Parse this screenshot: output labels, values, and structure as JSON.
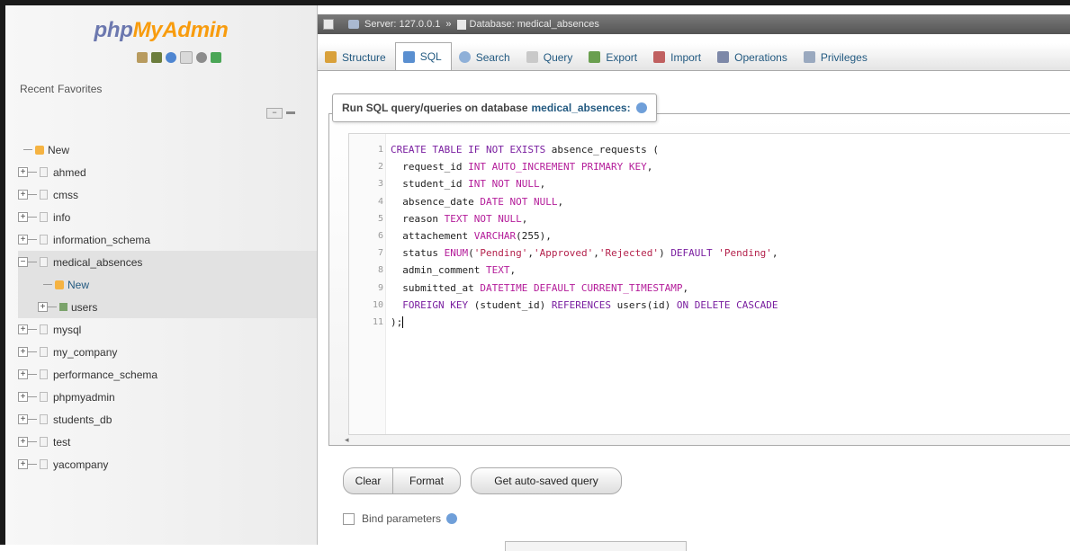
{
  "sidebar": {
    "logo_part1": "php",
    "logo_part2": "MyAdmin",
    "recent_tab": "Recent",
    "favorites_tab": "Favorites",
    "tree": [
      {
        "label": "New"
      },
      {
        "label": "ahmed"
      },
      {
        "label": "cmss"
      },
      {
        "label": "info"
      },
      {
        "label": "information_schema"
      },
      {
        "label": "medical_absences"
      },
      {
        "label": "New"
      },
      {
        "label": "users"
      },
      {
        "label": "mysql"
      },
      {
        "label": "my_company"
      },
      {
        "label": "performance_schema"
      },
      {
        "label": "phpmyadmin"
      },
      {
        "label": "students_db"
      },
      {
        "label": "test"
      },
      {
        "label": "yacompany"
      }
    ]
  },
  "breadcrumb": {
    "server": "Server: 127.0.0.1",
    "separator": "»",
    "database": "Database: medical_absences"
  },
  "tabs": [
    {
      "label": "Structure"
    },
    {
      "label": "SQL"
    },
    {
      "label": "Search"
    },
    {
      "label": "Query"
    },
    {
      "label": "Export"
    },
    {
      "label": "Import"
    },
    {
      "label": "Operations"
    },
    {
      "label": "Privileges"
    }
  ],
  "sql_panel": {
    "legend_prefix": "Run SQL query/queries on database",
    "legend_db": "medical_absences:",
    "lines": [
      {
        "n": "1",
        "segs": [
          {
            "t": "CREATE TABLE IF NOT EXISTS",
            "c": "kw"
          },
          {
            "t": " absence_requests (",
            "c": ""
          }
        ]
      },
      {
        "n": "2",
        "segs": [
          {
            "t": "  request_id ",
            "c": ""
          },
          {
            "t": "INT AUTO_INCREMENT PRIMARY KEY",
            "c": "ty"
          },
          {
            "t": ",",
            "c": ""
          }
        ]
      },
      {
        "n": "3",
        "segs": [
          {
            "t": "  student_id ",
            "c": ""
          },
          {
            "t": "INT NOT NULL",
            "c": "ty"
          },
          {
            "t": ",",
            "c": ""
          }
        ]
      },
      {
        "n": "4",
        "segs": [
          {
            "t": "  absence_date ",
            "c": ""
          },
          {
            "t": "DATE NOT NULL",
            "c": "ty"
          },
          {
            "t": ",",
            "c": ""
          }
        ]
      },
      {
        "n": "5",
        "segs": [
          {
            "t": "  reason ",
            "c": ""
          },
          {
            "t": "TEXT NOT NULL",
            "c": "ty"
          },
          {
            "t": ",",
            "c": ""
          }
        ]
      },
      {
        "n": "6",
        "segs": [
          {
            "t": "  attachement ",
            "c": ""
          },
          {
            "t": "VARCHAR",
            "c": "ty"
          },
          {
            "t": "(255),",
            "c": ""
          }
        ]
      },
      {
        "n": "7",
        "segs": [
          {
            "t": "  status ",
            "c": ""
          },
          {
            "t": "ENUM",
            "c": "ty"
          },
          {
            "t": "(",
            "c": ""
          },
          {
            "t": "'Pending'",
            "c": "st"
          },
          {
            "t": ",",
            "c": ""
          },
          {
            "t": "'Approved'",
            "c": "st"
          },
          {
            "t": ",",
            "c": ""
          },
          {
            "t": "'Rejected'",
            "c": "st"
          },
          {
            "t": ") ",
            "c": ""
          },
          {
            "t": "DEFAULT",
            "c": "kw"
          },
          {
            "t": " ",
            "c": ""
          },
          {
            "t": "'Pending'",
            "c": "st"
          },
          {
            "t": ",",
            "c": ""
          }
        ]
      },
      {
        "n": "8",
        "segs": [
          {
            "t": "  admin_comment ",
            "c": ""
          },
          {
            "t": "TEXT",
            "c": "ty"
          },
          {
            "t": ",",
            "c": ""
          }
        ]
      },
      {
        "n": "9",
        "segs": [
          {
            "t": "  submitted_at ",
            "c": ""
          },
          {
            "t": "DATETIME DEFAULT CURRENT_TIMESTAMP",
            "c": "ty"
          },
          {
            "t": ",",
            "c": ""
          }
        ]
      },
      {
        "n": "10",
        "segs": [
          {
            "t": "  FOREIGN KEY",
            "c": "kw"
          },
          {
            "t": " (student_id) ",
            "c": ""
          },
          {
            "t": "REFERENCES",
            "c": "kw"
          },
          {
            "t": " users(id) ",
            "c": ""
          },
          {
            "t": "ON DELETE CASCADE",
            "c": "kw"
          }
        ]
      },
      {
        "n": "11",
        "segs": [
          {
            "t": ");",
            "c": ""
          }
        ]
      }
    ]
  },
  "buttons": {
    "clear": "Clear",
    "format": "Format",
    "auto_saved": "Get auto-saved query"
  },
  "bind_parameters": "Bind parameters",
  "colors": {
    "logo_blue": "#6c78af",
    "logo_orange": "#f89c0e",
    "link": "#235a81"
  }
}
